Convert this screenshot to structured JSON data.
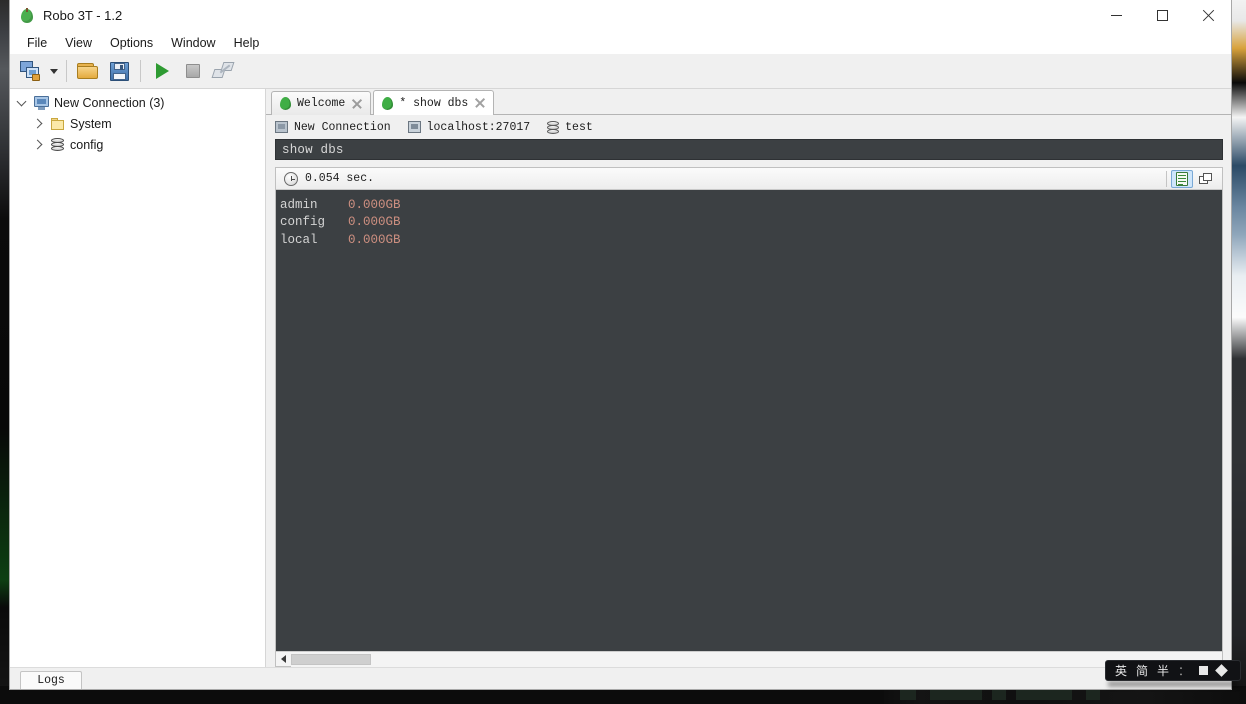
{
  "window": {
    "title": "Robo 3T - 1.2",
    "app_icon": "leaf-icon",
    "minimize": "minimize-icon",
    "maximize": "maximize-icon",
    "close": "close-icon"
  },
  "menu": {
    "items": [
      {
        "label": "File"
      },
      {
        "label": "View"
      },
      {
        "label": "Options"
      },
      {
        "label": "Window"
      },
      {
        "label": "Help"
      }
    ]
  },
  "toolbar": {
    "buttons": [
      {
        "name": "connect-button",
        "icon": "connect-icon"
      },
      {
        "name": "connect-dropdown",
        "icon": "chevron-down-icon"
      },
      {
        "name": "open-script-button",
        "icon": "folder-open-icon"
      },
      {
        "name": "save-script-button",
        "icon": "save-floppy-icon"
      },
      {
        "name": "execute-button",
        "icon": "play-icon"
      },
      {
        "name": "stop-button",
        "icon": "stop-square-icon"
      },
      {
        "name": "explain-button",
        "icon": "explain-icon"
      }
    ]
  },
  "sidebar": {
    "items": [
      {
        "label": "New Connection (3)",
        "icon": "connection-icon",
        "expanded": true,
        "level": 1
      },
      {
        "label": "System",
        "icon": "folder-icon",
        "expanded": false,
        "level": 2
      },
      {
        "label": "config",
        "icon": "database-icon",
        "expanded": false,
        "level": 2
      }
    ]
  },
  "tabs": [
    {
      "label": "Welcome",
      "icon": "leaf-icon",
      "active": false,
      "close": "close-icon"
    },
    {
      "label": "* show dbs",
      "icon": "leaf-icon",
      "active": true,
      "close": "close-icon"
    }
  ],
  "connection_bar": {
    "connection": "New Connection",
    "host": "localhost:27017",
    "database": "test",
    "connection_icon": "server-icon",
    "host_icon": "host-icon",
    "database_icon": "database-icon"
  },
  "editor": {
    "query": "show dbs"
  },
  "results": {
    "timing": "0.054 sec.",
    "timing_icon": "clock-icon",
    "view_buttons": [
      {
        "name": "text-view-button",
        "icon": "document-icon",
        "selected": true
      },
      {
        "name": "tree-view-button",
        "icon": "cascade-windows-icon",
        "selected": false
      }
    ],
    "rows": [
      {
        "name": "admin",
        "size": "0.000GB"
      },
      {
        "name": "config",
        "size": "0.000GB"
      },
      {
        "name": "local",
        "size": "0.000GB"
      }
    ]
  },
  "statusbar": {
    "logs_tab": "Logs"
  },
  "ime": {
    "lang": "英",
    "mode": "简",
    "width": "半",
    "sep": "：",
    "shape_icon": "square-icon",
    "extra_icon": "diamond-icon"
  },
  "colors": {
    "accent_green": "#2e9b32",
    "editor_bg": "#3c4043",
    "result_name": "#d4d4d4",
    "result_size": "#cd8f80",
    "tab_active_bg": "#ffffff",
    "window_bg": "#f0f0f0"
  }
}
